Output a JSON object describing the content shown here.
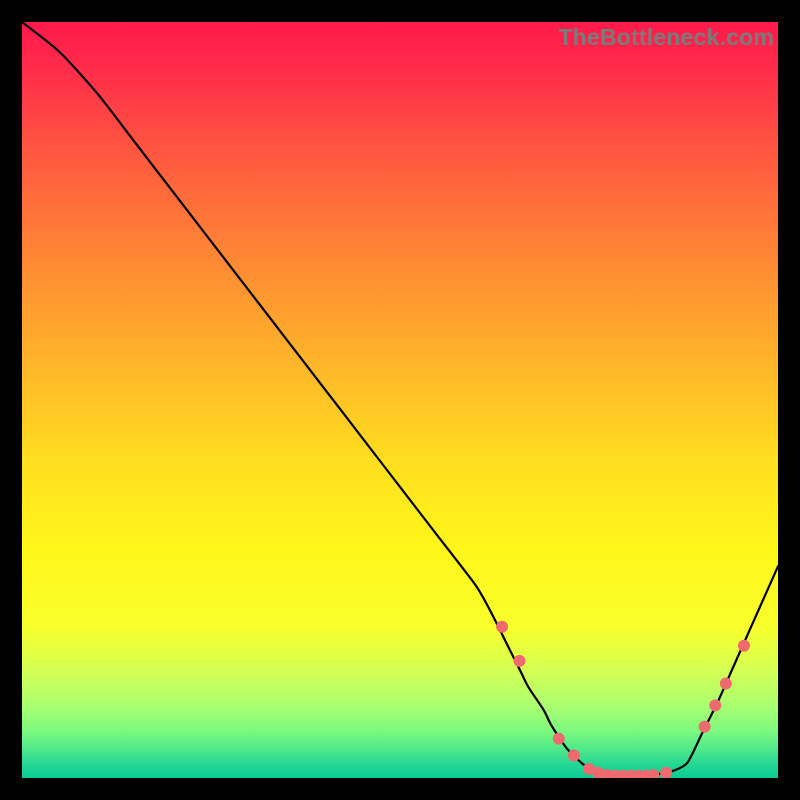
{
  "watermark": "TheBottleneck.com",
  "chart_data": {
    "type": "line",
    "title": "",
    "xlabel": "",
    "ylabel": "",
    "xlim": [
      0,
      100
    ],
    "ylim": [
      0,
      100
    ],
    "grid": false,
    "series": [
      {
        "name": "curve",
        "x": [
          0,
          5,
          10,
          15,
          20,
          25,
          30,
          35,
          40,
          45,
          50,
          55,
          60,
          62,
          64,
          66,
          67,
          69,
          70,
          72,
          74,
          76,
          78,
          80,
          82,
          84,
          86,
          88,
          90,
          92,
          94,
          96,
          98,
          100
        ],
        "values": [
          100,
          96,
          90.5,
          84,
          77.5,
          71,
          64.5,
          58,
          51.5,
          45,
          38.5,
          32,
          25.5,
          22,
          18,
          14,
          12,
          9,
          7,
          4,
          2,
          0.7,
          0.3,
          0.3,
          0.3,
          0.5,
          0.9,
          2.0,
          6.0,
          10,
          14.5,
          19,
          23.5,
          28
        ]
      }
    ],
    "markers": {
      "name": "highlight-points",
      "color": "#ee6a6e",
      "x": [
        63.5,
        65.8,
        71,
        73,
        75,
        76.2,
        77.4,
        78.5,
        79.5,
        80.5,
        81.5,
        82.5,
        83.5,
        85.2,
        90.3,
        91.7,
        93.1,
        95.5
      ],
      "values": [
        20,
        15.5,
        5.2,
        3.0,
        1.2,
        0.7,
        0.4,
        0.3,
        0.3,
        0.3,
        0.3,
        0.3,
        0.4,
        0.7,
        6.8,
        9.6,
        12.5,
        17.5
      ]
    },
    "gradient_stops": [
      {
        "offset": 0.0,
        "color": "#ff1a4b"
      },
      {
        "offset": 0.06,
        "color": "#ff2b4a"
      },
      {
        "offset": 0.18,
        "color": "#ff5a3f"
      },
      {
        "offset": 0.32,
        "color": "#ff8a33"
      },
      {
        "offset": 0.46,
        "color": "#ffb828"
      },
      {
        "offset": 0.58,
        "color": "#ffde1f"
      },
      {
        "offset": 0.7,
        "color": "#fff71a"
      },
      {
        "offset": 0.8,
        "color": "#f8ff2b"
      },
      {
        "offset": 0.86,
        "color": "#d3ff55"
      },
      {
        "offset": 0.905,
        "color": "#a9ff70"
      },
      {
        "offset": 0.938,
        "color": "#7cf97e"
      },
      {
        "offset": 0.962,
        "color": "#4fe88b"
      },
      {
        "offset": 0.982,
        "color": "#24d793"
      },
      {
        "offset": 1.0,
        "color": "#0acb94"
      }
    ]
  }
}
